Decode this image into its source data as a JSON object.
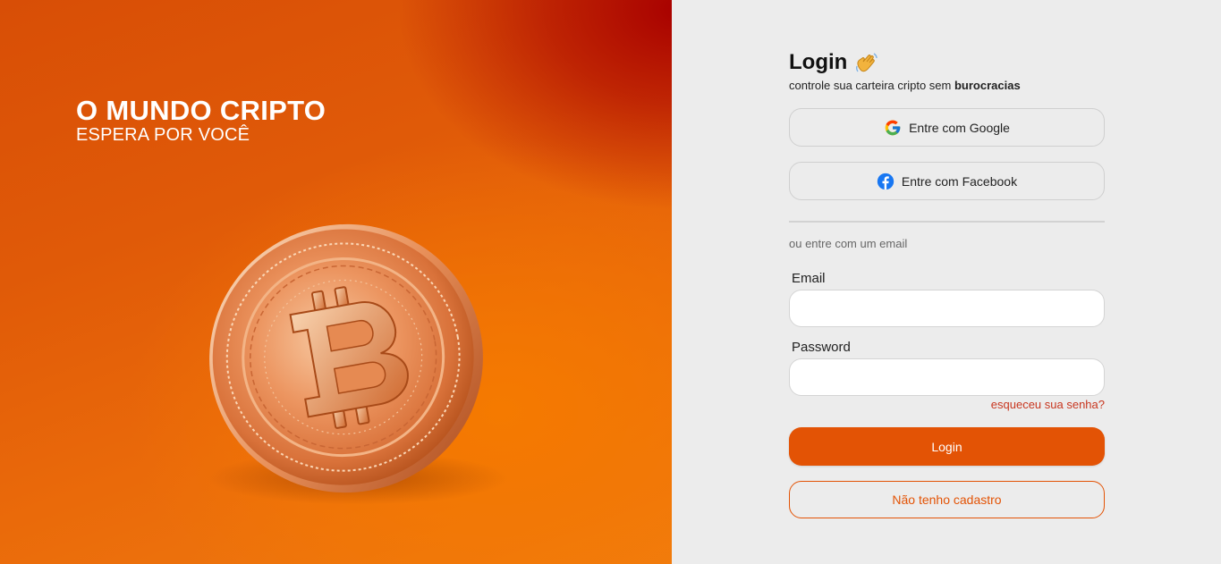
{
  "hero": {
    "title": "O MUNDO CRIPTO",
    "subtitle": "ESPERA POR VOCÊ",
    "coin_icon": "bitcoin-coin-icon"
  },
  "login": {
    "title": "Login",
    "title_icon": "waving-hand-icon",
    "tagline_prefix": "controle sua carteira cripto sem ",
    "tagline_bold": "burocracias",
    "google_label": "Entre com Google",
    "google_icon": "google-icon",
    "facebook_label": "Entre com Facebook",
    "facebook_icon": "facebook-icon",
    "or_text": "ou entre com um email",
    "email_label": "Email",
    "email_value": "",
    "password_label": "Password",
    "password_value": "",
    "forgot_label": "esqueceu sua senha?",
    "login_button": "Login",
    "register_button": "Não tenho cadastro"
  },
  "colors": {
    "accent": "#e35305",
    "forgot_link": "#c8361f",
    "panel_bg": "#ececec"
  }
}
